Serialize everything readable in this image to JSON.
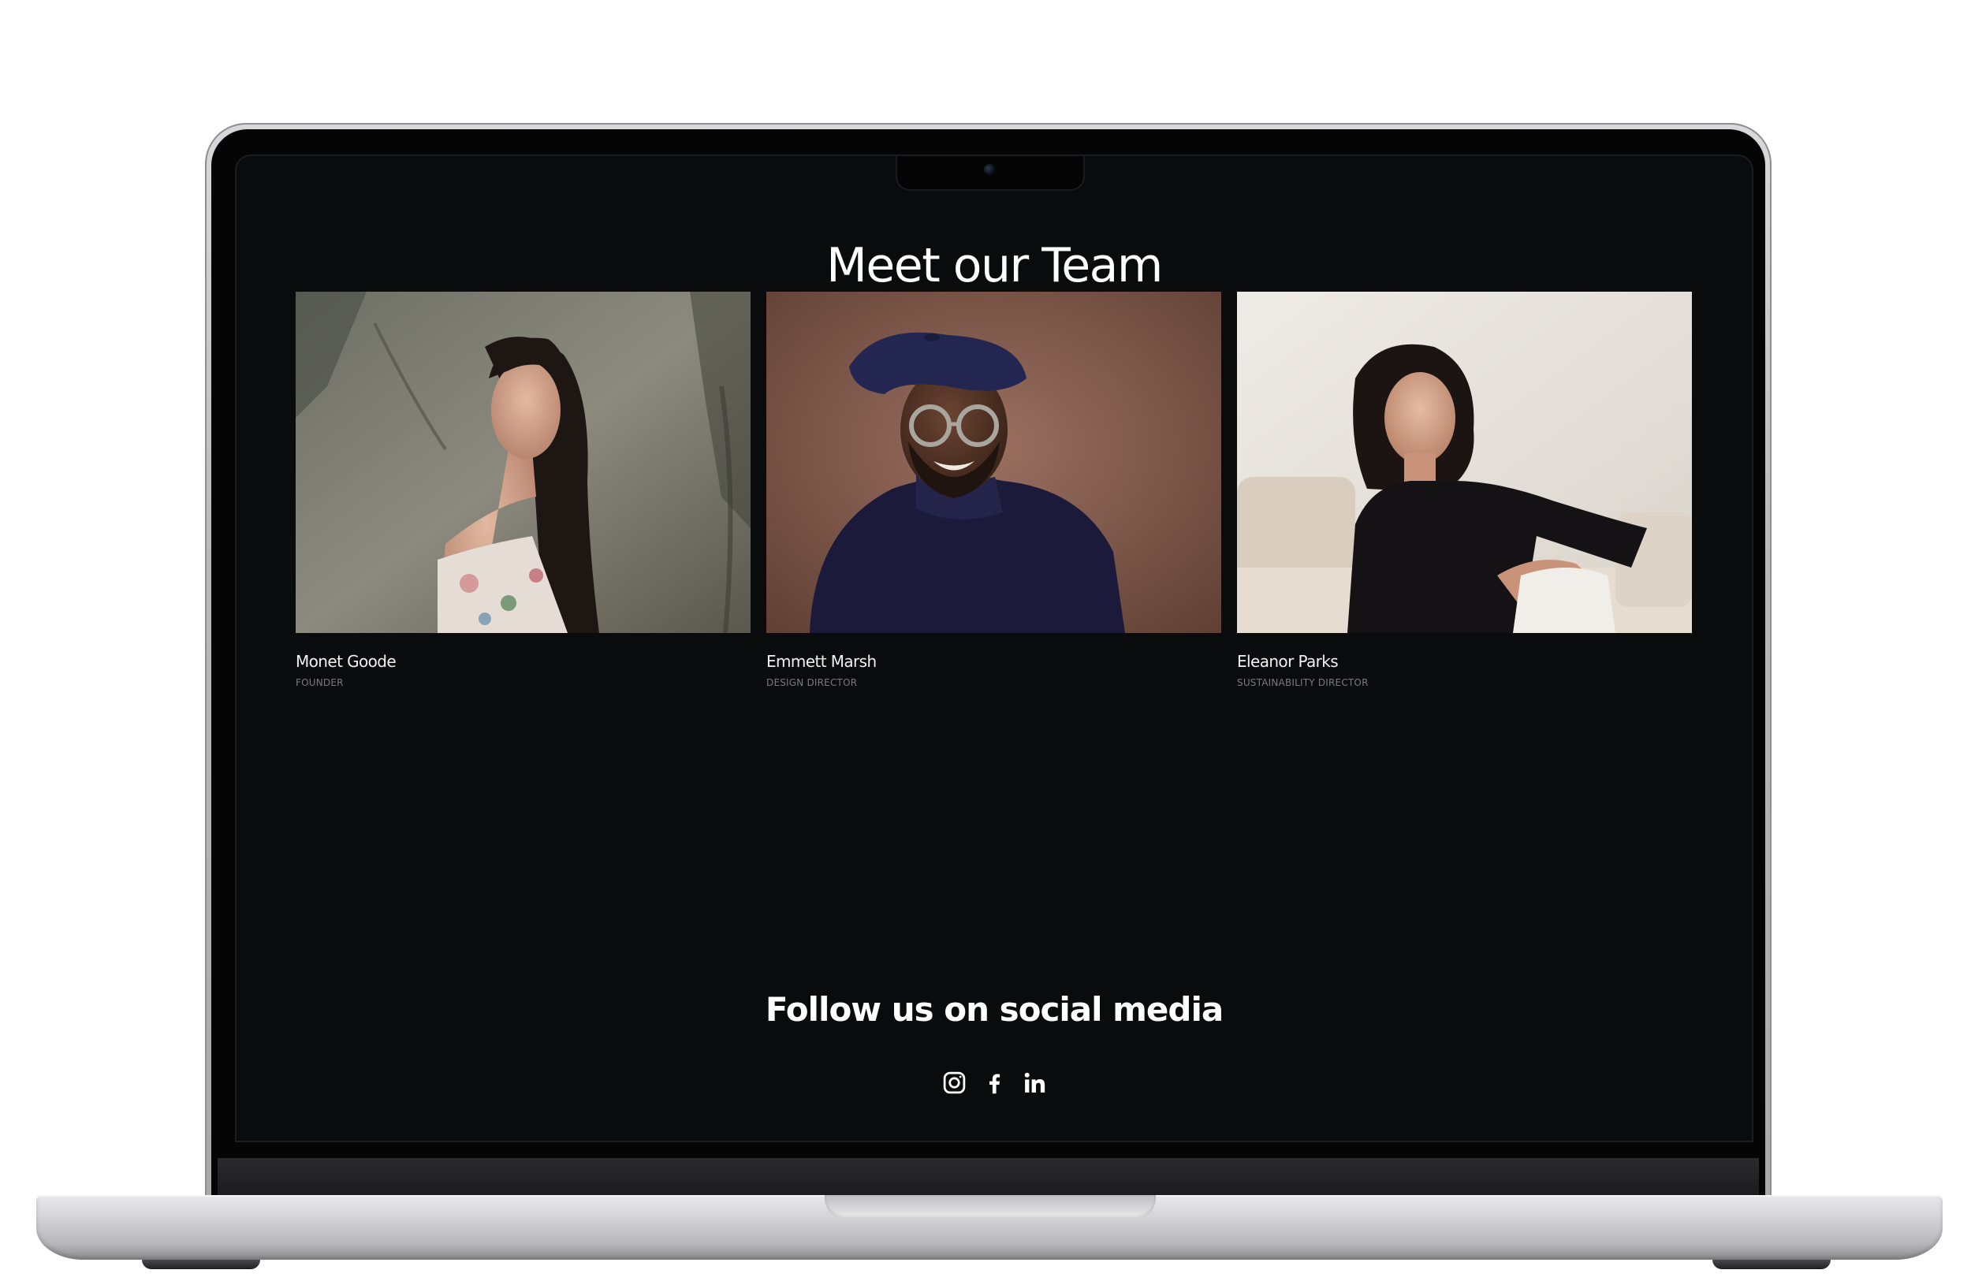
{
  "team": {
    "title": "Meet our Team",
    "members": [
      {
        "name": "Monet Goode",
        "role": "FOUNDER"
      },
      {
        "name": "Emmett Marsh",
        "role": "DESIGN DIRECTOR"
      },
      {
        "name": "Eleanor Parks",
        "role": "SUSTAINABILITY DIRECTOR"
      }
    ]
  },
  "social": {
    "title": "Follow us on social media",
    "icons": [
      "instagram-icon",
      "facebook-icon",
      "linkedin-icon"
    ]
  },
  "colors": {
    "page_background": "#0a0b0d",
    "text_primary": "#ffffff",
    "text_muted": "#7a7b7e",
    "laptop_silver": "#c9c9cd"
  }
}
